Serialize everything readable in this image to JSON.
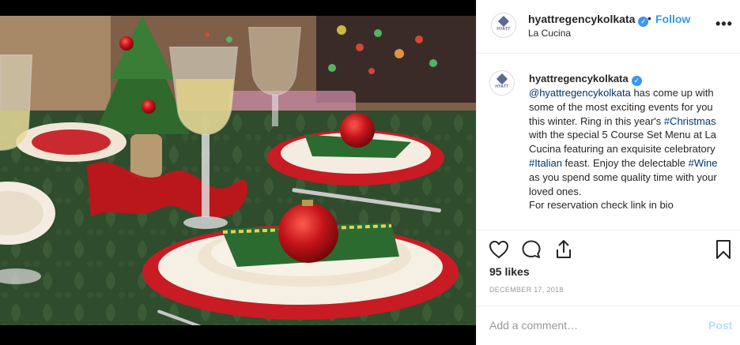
{
  "post": {
    "username": "hyattregencykolkata",
    "follow_label": "Follow",
    "separator": "•",
    "location": "La Cucina",
    "more_label": "•••",
    "avatar_text": "HYATT",
    "verified_mark": "✓",
    "likes": "95 likes",
    "date": "DECEMBER 17, 2018"
  },
  "caption": {
    "mention": "@hyattregencykolkata",
    "text_1": " has come up with some of the most exciting events for you this winter. Ring in this year's ",
    "hashtag_1": "#Christmas",
    "text_2": " with the special 5 Course Set Menu at La Cucina featuring an exquisite celebratory ",
    "hashtag_2": "#Italian",
    "text_3": " feast. Enjoy the delectable ",
    "hashtag_3": "#Wine",
    "text_4": " as you spend some quality time with your loved ones.",
    "text_5": "For reservation check link in bio"
  },
  "comment": {
    "placeholder": "Add a comment…",
    "post_label": "Post"
  },
  "icons": {
    "like": "heart-icon",
    "comment": "comment-icon",
    "share": "share-icon",
    "save": "bookmark-icon",
    "more": "more-options-icon",
    "verified": "verified-badge-icon"
  },
  "colors": {
    "accent": "#3897f0",
    "hashtag": "#003569",
    "post_disabled": "#b2dffc",
    "muted": "#999999"
  }
}
